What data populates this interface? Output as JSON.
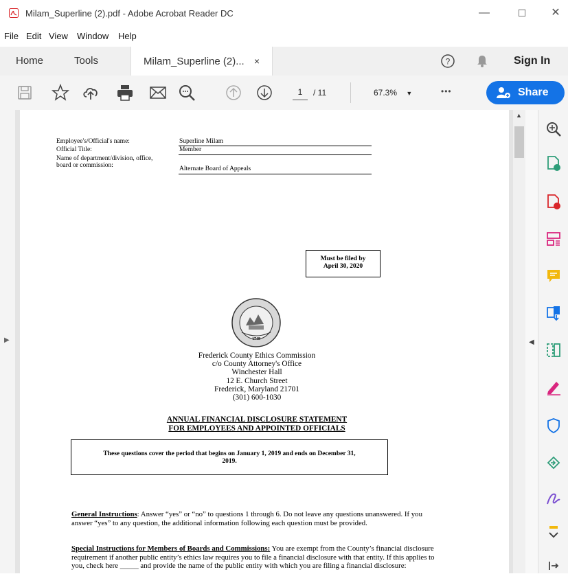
{
  "window": {
    "title": "Milam_Superline (2).pdf - Adobe Acrobat Reader DC",
    "minimize": "—",
    "maximize": "☐",
    "close": "✕"
  },
  "menu": [
    "File",
    "Edit",
    "View",
    "Window",
    "Help"
  ],
  "tabs": {
    "home": "Home",
    "tools": "Tools",
    "document": "Milam_Superline (2)...",
    "document_close": "×",
    "sign_in": "Sign In"
  },
  "toolbar": {
    "page_current": "1",
    "page_total": "/ 11",
    "zoom": "67.3%",
    "more": "•••",
    "share": "Share"
  },
  "document": {
    "header": {
      "name_label": "Employee's/Official's name:",
      "name_value": "Superline Milam",
      "title_label": "Official Title:",
      "title_value": "Member",
      "dept_label_1": "Name of department/division, office,",
      "dept_label_2": "board or commission:",
      "dept_value": "Alternate Board of Appeals"
    },
    "deadline_1": "Must be filed by",
    "deadline_2": "April 30, 2020",
    "seal_text": "FREDERICK COUNTY MARYLAND",
    "seal_year": "1748",
    "address": [
      "Frederick County Ethics Commission",
      "c/o County Attorney's Office",
      "Winchester Hall",
      "12 E. Church Street",
      "Frederick, Maryland  21701",
      "(301) 600-1030"
    ],
    "heading_1": "ANNUAL FINANCIAL DISCLOSURE STATEMENT",
    "heading_2": "FOR EMPLOYEES AND APPOINTED OFFICIALS",
    "period_1": "These questions cover the period that begins on January 1, 2019 and ends on December 31,",
    "period_2": "2019.",
    "general_heading": "General Instructions",
    "general_text": ":  Answer “yes” or “no” to questions 1 through 6.  Do not leave any questions unanswered.  If you answer “yes” to any question, the additional information following each question must be provided.",
    "special_heading": "Special Instructions for Members of Boards and Commissions:",
    "special_text": "  You are exempt from the County’s financial disclosure requirement if another public entity’s ethics law requires you to file a financial disclosure with that entity.  If this applies to you, check here _____ and provide the name of the public entity with which you are filing a financial disclosure:"
  },
  "colors": {
    "share_blue": "#1473e6",
    "acrobat_red": "#d9262a"
  }
}
